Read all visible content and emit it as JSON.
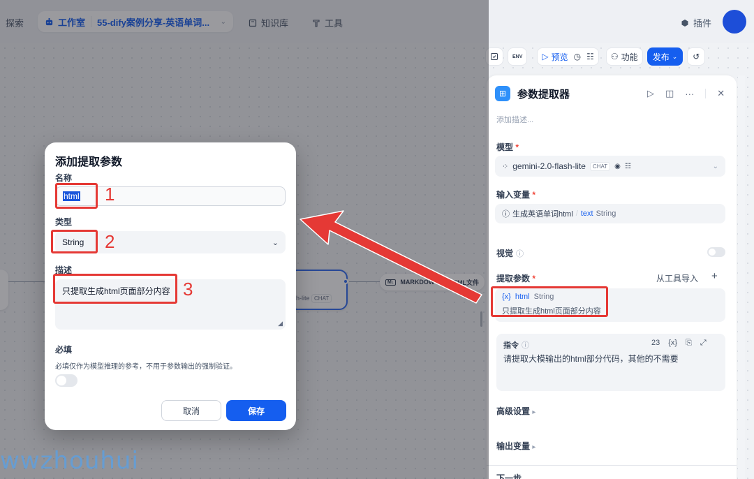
{
  "topnav": {
    "explore": "探索",
    "studio": "工作室",
    "app_name": "55-dify案例分享-英语单词...",
    "knowledge": "知识库",
    "tools": "工具",
    "plugins": "插件"
  },
  "toolbar": {
    "env": "ENV",
    "preview": "预览",
    "features": "功能",
    "publish": "发布"
  },
  "canvas": {
    "llm_label": "h-lite",
    "llm_chip": "CHAT",
    "md_node_prefix": "MARKDOW",
    "md_node_suffix": "HTML文件"
  },
  "panel": {
    "title": "参数提取器",
    "desc_placeholder": "添加描述...",
    "model_label": "模型",
    "model_name": "gemini-2.0-flash-lite",
    "model_chip": "CHAT",
    "input_label": "输入变量",
    "input_source": "生成英语单词html",
    "input_var": "text",
    "input_type": "String",
    "vision_label": "视觉",
    "extract_label": "提取参数",
    "import_from_tool": "从工具导入",
    "param_name": "html",
    "param_type": "String",
    "param_desc": "只提取生成html页面部分内容",
    "instruction_label": "指令",
    "instruction_count": "23",
    "instruction_text": "请提取大模输出的html部分代码，其他的不需要",
    "advanced": "高级设置",
    "output_vars": "输出变量",
    "next_step": "下一步"
  },
  "modal": {
    "title": "添加提取参数",
    "name_label": "名称",
    "name_value": "html",
    "type_label": "类型",
    "type_value": "String",
    "desc_label": "描述",
    "desc_value": "只提取生成html页面部分内容",
    "required_label": "必填",
    "required_hint": "必填仅作为模型推理的参考，不用于参数输出的强制验证。",
    "cancel": "取消",
    "save": "保存"
  },
  "annotations": {
    "n1": "1",
    "n2": "2",
    "n3": "3",
    "color": "#e53935"
  },
  "watermark": "wwzhouhui",
  "colors": {
    "primary": "#155eef",
    "avatar": "#1d4ed8"
  }
}
